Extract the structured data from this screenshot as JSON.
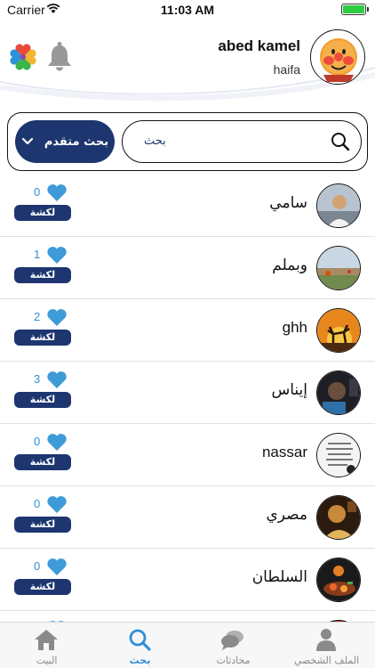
{
  "status_bar": {
    "carrier": "Carrier",
    "time": "11:03 AM"
  },
  "profile": {
    "name": "abed kamel",
    "city": "haifa"
  },
  "search": {
    "placeholder": "بحث",
    "advanced_label": "بحث متقدم"
  },
  "users": [
    {
      "name": "سامي",
      "likes": "0",
      "wink_label": "لكشة",
      "avatar": "person-photo"
    },
    {
      "name": "وبملم",
      "likes": "1",
      "wink_label": "لكشة",
      "avatar": "landscape-photo"
    },
    {
      "name": "ghh",
      "likes": "2",
      "wink_label": "لكشة",
      "avatar": "deer-sunset-photo"
    },
    {
      "name": "إيناس",
      "likes": "3",
      "wink_label": "لكشة",
      "avatar": "dark-selfie-photo"
    },
    {
      "name": "nassar",
      "likes": "0",
      "wink_label": "لكشة",
      "avatar": "text-note-photo"
    },
    {
      "name": "مصري",
      "likes": "0",
      "wink_label": "لكشة",
      "avatar": "golden-photo"
    },
    {
      "name": "السلطان",
      "likes": "0",
      "wink_label": "لكشة",
      "avatar": "food-dish-photo"
    }
  ],
  "tabs": [
    {
      "label": "الملف الشخصي",
      "icon": "person-icon",
      "active": false
    },
    {
      "label": "محادثات",
      "icon": "chat-bubbles-icon",
      "active": false
    },
    {
      "label": "بحث",
      "icon": "search-icon",
      "active": true
    },
    {
      "label": "البيت",
      "icon": "home-icon",
      "active": false
    }
  ],
  "colors": {
    "primary": "#1d3670",
    "accent": "#2f8fd8",
    "heart": "#3f9ad8",
    "battery": "#2ecc40"
  }
}
